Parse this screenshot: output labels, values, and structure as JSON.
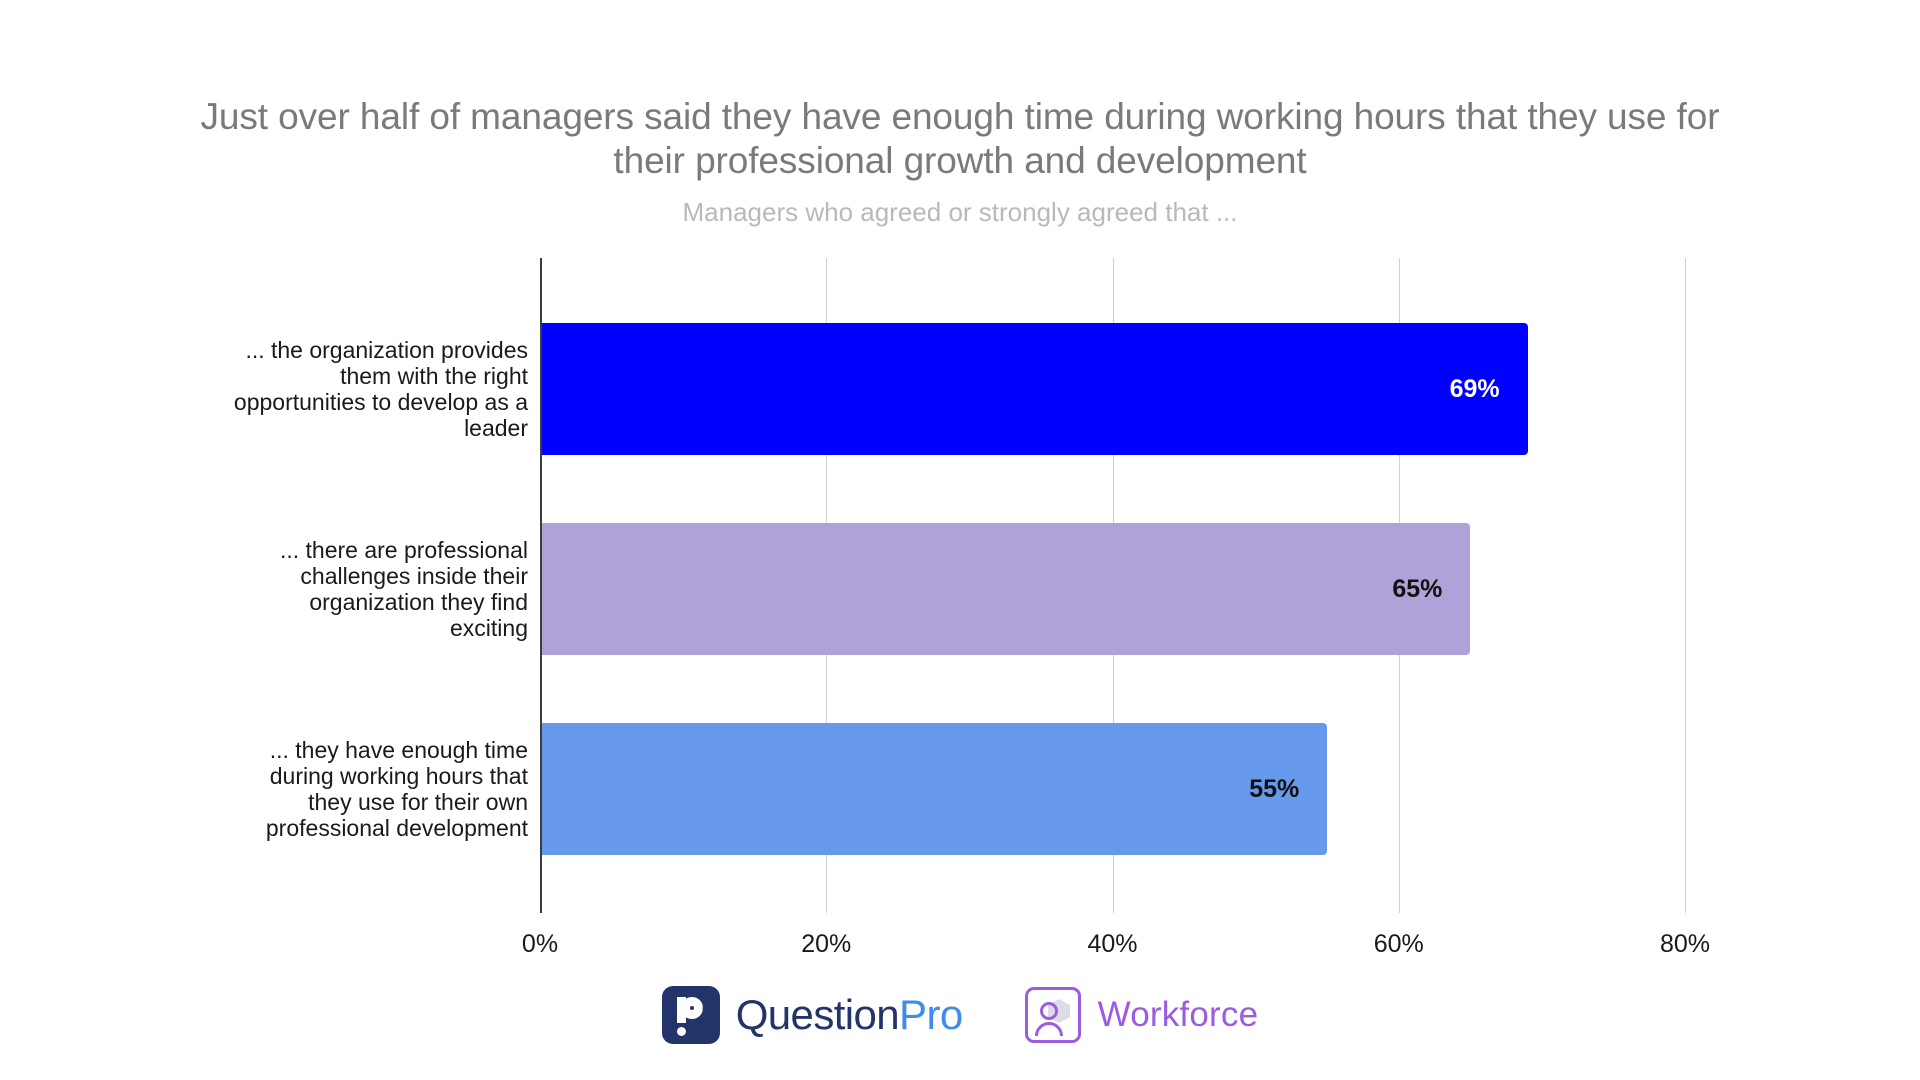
{
  "chart_data": {
    "type": "bar",
    "orientation": "horizontal",
    "title": "Just over half of managers said they have enough time during working hours that they use for their professional growth and development",
    "subtitle": "Managers who agreed or strongly agreed that ...",
    "xlabel": "",
    "ylabel": "",
    "xlim": [
      0,
      80
    ],
    "xticks": [
      "0%",
      "20%",
      "40%",
      "60%",
      "80%"
    ],
    "xtick_values": [
      0,
      20,
      40,
      60,
      80
    ],
    "grid": "vertical",
    "legend": "none",
    "categories": [
      "... the organization provides them with the right opportunities to develop as a leader",
      "... there are professional challenges inside their organization they find exciting",
      "... they have enough time during working hours that they use for their own professional development"
    ],
    "values": [
      69,
      65,
      55
    ],
    "value_labels": [
      "69%",
      "65%",
      "55%"
    ],
    "bar_colors": [
      "#0000FF",
      "#B0A2D8",
      "#6699EB"
    ],
    "value_label_colors": [
      "#FFFFFF",
      "#111111",
      "#111111"
    ]
  },
  "footer": {
    "questionpro": {
      "mark_label": "questionpro-logo-mark",
      "word_part1": "Question",
      "word_part2": "Pro",
      "color_dark": "#23346B",
      "color_light": "#3D8BEA"
    },
    "workforce": {
      "mark_label": "workforce-logo-mark",
      "word": "Workforce",
      "color": "#9A5CE0"
    }
  }
}
